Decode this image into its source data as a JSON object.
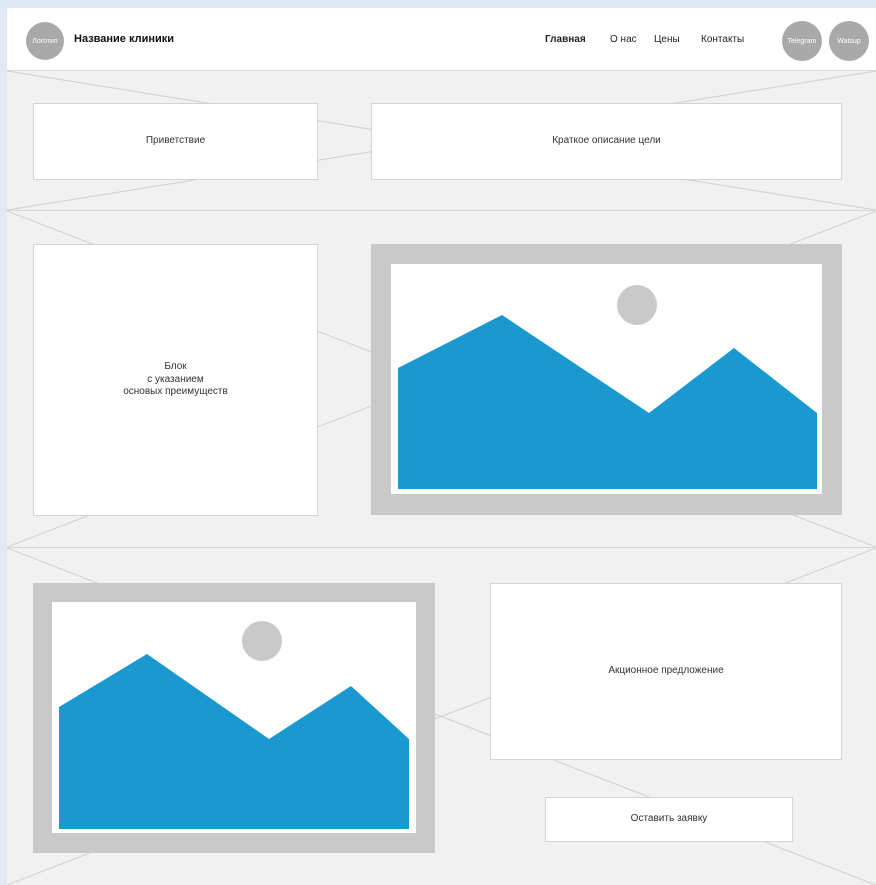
{
  "header": {
    "logo_label": "Логотип",
    "clinic_name": "Название клиники",
    "nav": [
      {
        "label": "Главная",
        "active": true
      },
      {
        "label": "О нас",
        "active": false
      },
      {
        "label": "Цены",
        "active": false
      },
      {
        "label": "Контакты",
        "active": false
      }
    ],
    "social": [
      {
        "label": "Telegram"
      },
      {
        "label": "Watsup"
      }
    ]
  },
  "section1": {
    "greeting": "Приветствие",
    "goal": "Краткое описание цели"
  },
  "section2": {
    "advantages_line1": "Блок",
    "advantages_line2": "с указанием",
    "advantages_line3": "основых преимуществ"
  },
  "section3": {
    "offer": "Акционное предложение",
    "cta": "Оставить заявку"
  },
  "colors": {
    "accent": "#1a98d0",
    "placeholder_gray": "#c9c9c9",
    "background": "#f1f1f1"
  }
}
